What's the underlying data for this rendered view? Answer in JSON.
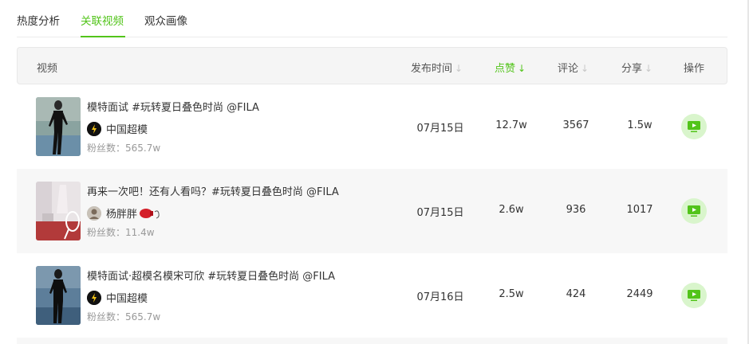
{
  "tabs": [
    "热度分析",
    "关联视频",
    "观众画像"
  ],
  "active_tab": 1,
  "table": {
    "headers": {
      "video": "视频",
      "publish_time": "发布时间",
      "likes": "点赞",
      "comments": "评论",
      "shares": "分享",
      "actions": "操作"
    },
    "sorted_by": "点赞",
    "sort_arrow": "↓",
    "rows": [
      {
        "title": "模特面试 #玩转夏日叠色时尚 @FILA",
        "author": "中国超模",
        "fans": "粉丝数：565.7w",
        "date": "07月15日",
        "likes": "12.7w",
        "comments": "3567",
        "shares": "1.5w"
      },
      {
        "title": "再来一次吧！还有人看吗？#玩转夏日叠色时尚 @FILA",
        "author": "杨胖胖",
        "fans": "粉丝数：11.4w",
        "date": "07月15日",
        "likes": "2.6w",
        "comments": "936",
        "shares": "1017"
      },
      {
        "title": "模特面试·超模名模宋可欣 #玩转夏日叠色时尚 @FILA",
        "author": "中国超模",
        "fans": "粉丝数：565.7w",
        "date": "07月16日",
        "likes": "2.5w",
        "comments": "424",
        "shares": "2449"
      }
    ]
  },
  "colors": {
    "accent": "#52c41a",
    "play_bg": "#d9f5cc"
  }
}
